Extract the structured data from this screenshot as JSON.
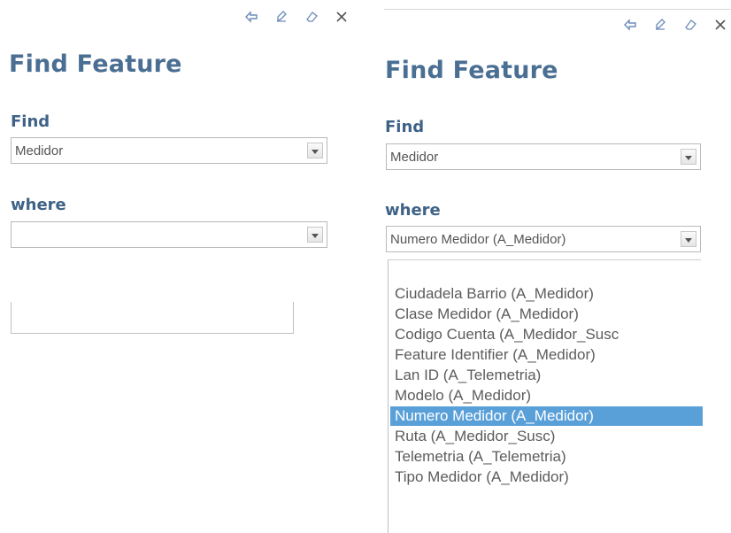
{
  "left_panel": {
    "title": "Find Feature",
    "find_label": "Find",
    "find_value": "Medidor",
    "where_label": "where",
    "where_value": ""
  },
  "right_panel": {
    "title": "Find Feature",
    "find_label": "Find",
    "find_value": "Medidor",
    "where_label": "where",
    "where_value": "Numero Medidor (A_Medidor)",
    "options": [
      "Ciudadela Barrio (A_Medidor)",
      "Clase Medidor (A_Medidor)",
      "Codigo Cuenta (A_Medidor_Susc",
      "Feature Identifier (A_Medidor)",
      "Lan ID (A_Telemetria)",
      "Modelo (A_Medidor)",
      "Numero Medidor (A_Medidor)",
      "Ruta (A_Medidor_Susc)",
      "Telemetria (A_Telemetria)",
      "Tipo Medidor (A_Medidor)"
    ],
    "selected_option": "Numero Medidor (A_Medidor)"
  },
  "toolbar_icons": [
    "back-arrow-icon",
    "edit-icon",
    "eraser-icon",
    "close-icon"
  ],
  "colors": {
    "title": "#4a6f93",
    "label": "#3f6287",
    "selection": "#5aa0d8",
    "toolbar_icon": "#6b8bb8"
  }
}
